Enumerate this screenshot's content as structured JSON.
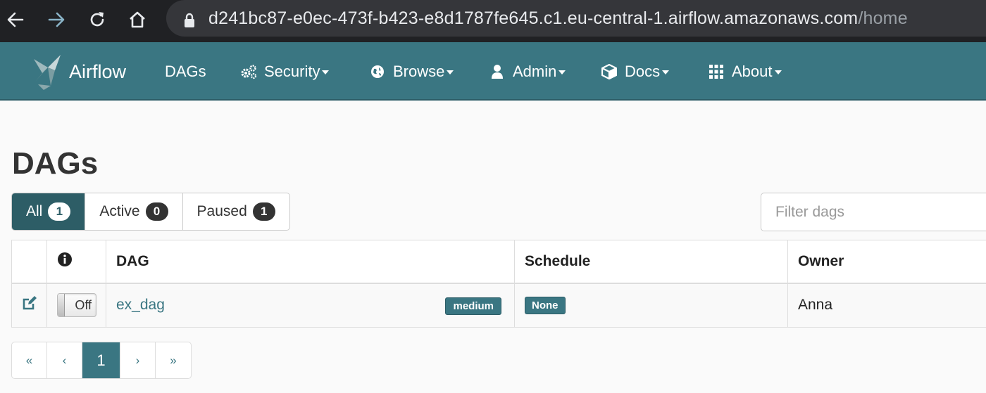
{
  "browser": {
    "url_host": "d241bc87-e0ec-473f-b423-e8d1787fe645.c1.eu-central-1.airflow.amazonaws.com",
    "url_path": "/home"
  },
  "navbar": {
    "brand": "Airflow",
    "items": [
      {
        "label": "DAGs",
        "icon": "none",
        "dropdown": false
      },
      {
        "label": "Security",
        "icon": "gears-icon",
        "dropdown": true
      },
      {
        "label": "Browse",
        "icon": "globe-icon",
        "dropdown": true
      },
      {
        "label": "Admin",
        "icon": "user-icon",
        "dropdown": true
      },
      {
        "label": "Docs",
        "icon": "cube-icon",
        "dropdown": true
      },
      {
        "label": "About",
        "icon": "grid-icon",
        "dropdown": true
      }
    ]
  },
  "page": {
    "title": "DAGs"
  },
  "filters": {
    "all": {
      "label": "All",
      "count": "1"
    },
    "active": {
      "label": "Active",
      "count": "0"
    },
    "paused": {
      "label": "Paused",
      "count": "1"
    }
  },
  "search": {
    "placeholder": "Filter dags"
  },
  "table": {
    "headers": {
      "info_icon": "info-icon",
      "dag": "DAG",
      "schedule": "Schedule",
      "owner": "Owner"
    },
    "rows": [
      {
        "toggle": "Off",
        "dag_id": "ex_dag",
        "tag": "medium",
        "schedule": "None",
        "owner": "Anna"
      }
    ]
  },
  "pagination": {
    "first": "«",
    "prev": "‹",
    "current": "1",
    "next": "›",
    "last": "»"
  },
  "colors": {
    "navbar": "#3a7682",
    "active_filter": "#2d5d66",
    "link": "#3a7682"
  }
}
